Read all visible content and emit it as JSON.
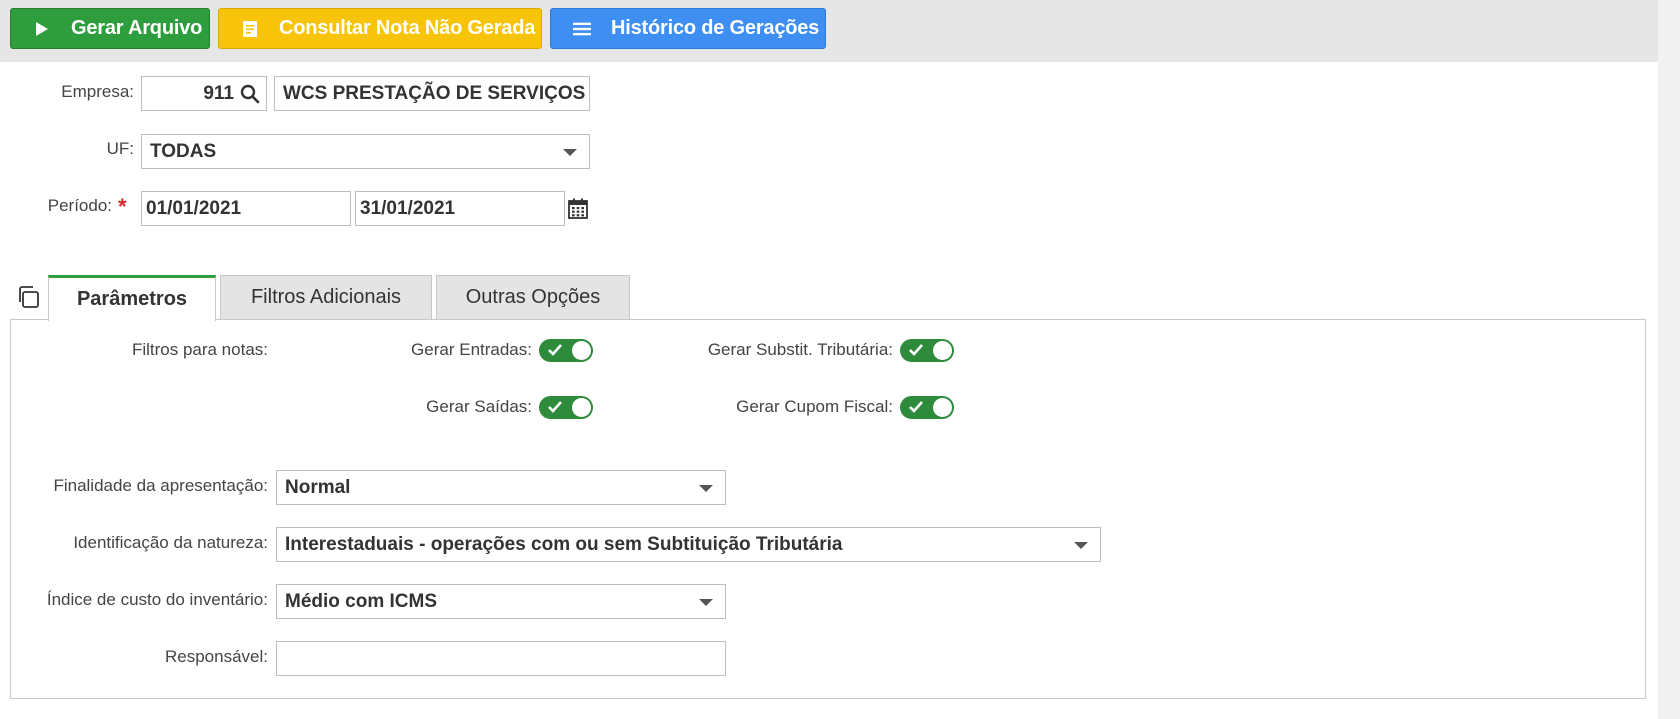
{
  "toolbar": {
    "generate_label": "Gerar Arquivo",
    "consult_label": "Consultar Nota Não Gerada",
    "history_label": "Histórico de Gerações"
  },
  "form": {
    "empresa_label": "Empresa:",
    "empresa_code": "911",
    "empresa_name": "WCS PRESTAÇÃO DE SERVIÇOS",
    "uf_label": "UF:",
    "uf_value": "TODAS",
    "periodo_label": "Período:",
    "periodo_required": "*",
    "periodo_start": "01/01/2021",
    "periodo_end": "31/01/2021"
  },
  "tabs": [
    {
      "label": "Parâmetros",
      "active": true
    },
    {
      "label": "Filtros Adicionais",
      "active": false
    },
    {
      "label": "Outras Opções",
      "active": false
    }
  ],
  "parametros": {
    "filtros_label": "Filtros para notas:",
    "toggles": {
      "entradas": {
        "label": "Gerar Entradas:",
        "on": true
      },
      "saidas": {
        "label": "Gerar Saídas:",
        "on": true
      },
      "substit": {
        "label": "Gerar Substit. Tributária:",
        "on": true
      },
      "cupom": {
        "label": "Gerar Cupom Fiscal:",
        "on": true
      }
    },
    "finalidade_label": "Finalidade da apresentação:",
    "finalidade_value": "Normal",
    "natureza_label": "Identificação da natureza:",
    "natureza_value": "Interestaduais - operações com ou sem Subtituição Tributária",
    "indice_label": "Índice de custo do inventário:",
    "indice_value": "Médio com ICMS",
    "responsavel_label": "Responsável:",
    "responsavel_value": ""
  },
  "colors": {
    "green": "#2e9d3e",
    "yellow": "#f7c40a",
    "blue": "#3f8ff2",
    "toggle_on": "#2e8b3c",
    "required": "#d9262c"
  }
}
